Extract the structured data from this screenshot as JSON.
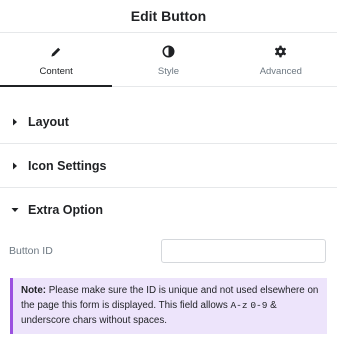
{
  "header": {
    "title": "Edit Button"
  },
  "tabs": [
    {
      "label": "Content",
      "icon": "pencil-icon",
      "active": true
    },
    {
      "label": "Style",
      "icon": "contrast-icon",
      "active": false
    },
    {
      "label": "Advanced",
      "icon": "gear-icon",
      "active": false
    }
  ],
  "sections": [
    {
      "title": "Layout",
      "expanded": false
    },
    {
      "title": "Icon Settings",
      "expanded": false
    },
    {
      "title": "Extra Option",
      "expanded": true
    }
  ],
  "button_id": {
    "label": "Button ID",
    "value": "",
    "placeholder": ""
  },
  "note": {
    "bold": "Note:",
    "text1": " Please make sure the ID is unique and not used elsewhere on the page this form is displayed. This field allows ",
    "code1": "A-z",
    "space": " ",
    "code2": "0-9",
    "text2": " & underscore chars without spaces."
  },
  "colors": {
    "accent": "#9b51e0",
    "note_bg": "#ede4fb",
    "text": "#1f2124",
    "muted": "#6d7882"
  }
}
